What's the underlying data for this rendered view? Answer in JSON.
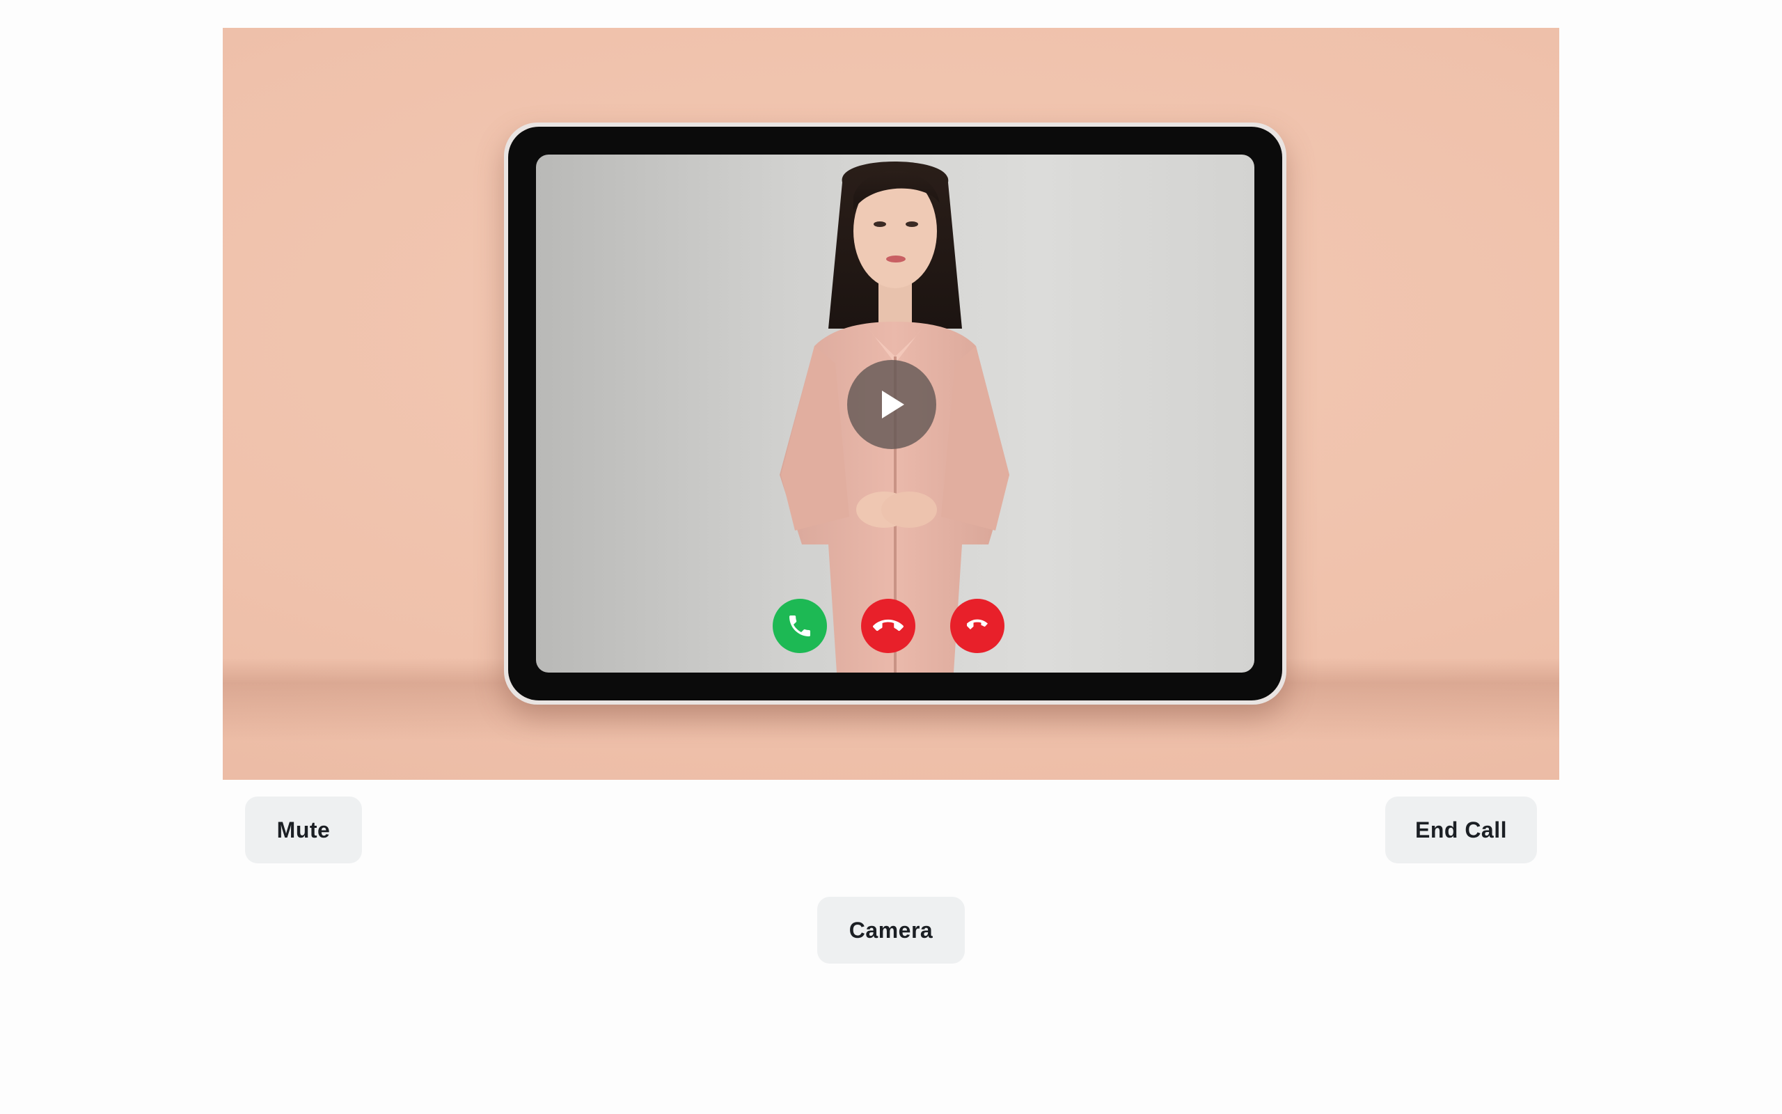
{
  "video": {
    "background_color": "#f0c4ae",
    "play_icon": "play-icon",
    "call_icons": [
      {
        "name": "accept-call-icon",
        "color": "#1db954"
      },
      {
        "name": "end-call-icon",
        "color": "#e8202a"
      },
      {
        "name": "decline-call-icon",
        "color": "#e8202a"
      }
    ]
  },
  "controls": {
    "mute_label": "Mute",
    "end_call_label": "End Call",
    "camera_label": "Camera"
  }
}
